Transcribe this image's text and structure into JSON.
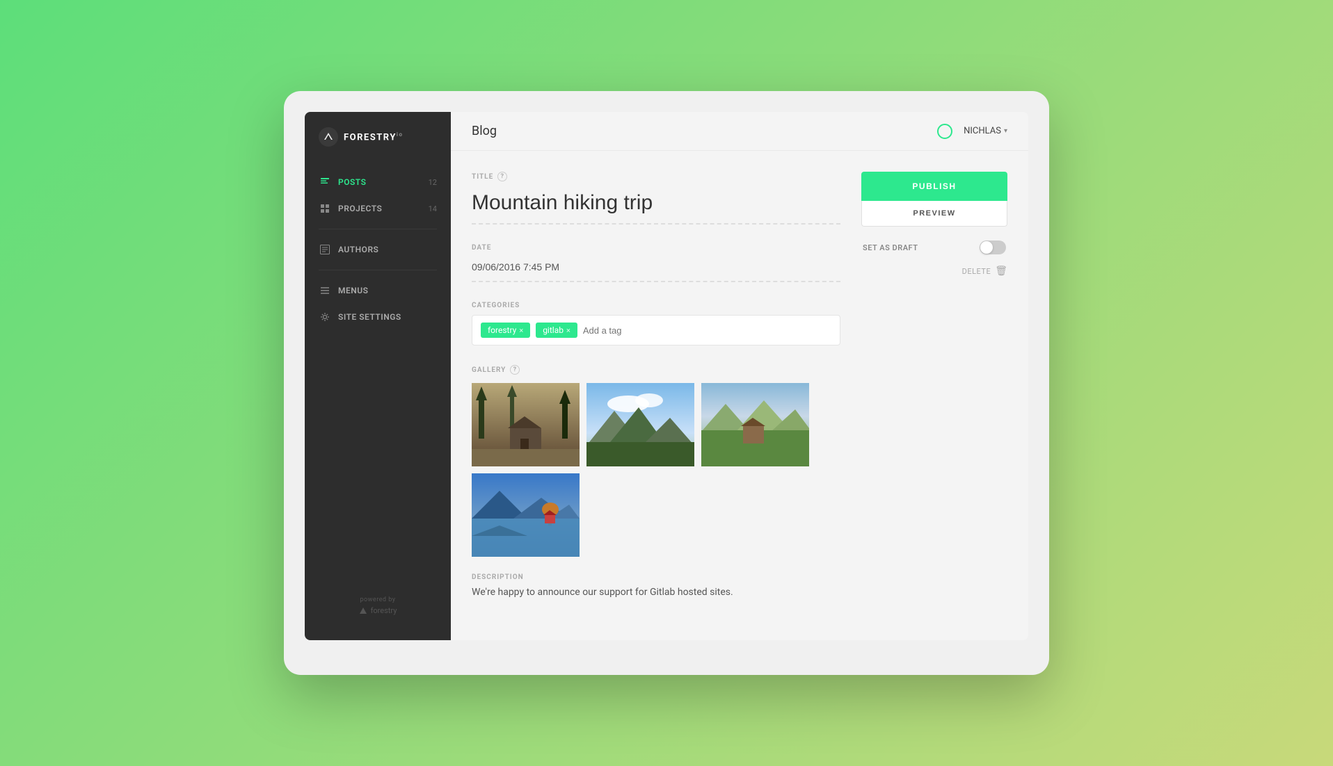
{
  "app": {
    "logo_text": "FORESTRY",
    "logo_version": "io"
  },
  "sidebar": {
    "items": [
      {
        "id": "posts",
        "label": "POSTS",
        "count": "12",
        "active": true
      },
      {
        "id": "projects",
        "label": "PROJECTS",
        "count": "14",
        "active": false
      },
      {
        "id": "authors",
        "label": "AUTHORS",
        "count": "",
        "active": false
      },
      {
        "id": "menus",
        "label": "MENUS",
        "count": "",
        "active": false
      },
      {
        "id": "site-settings",
        "label": "SITE SETTINGS",
        "count": "",
        "active": false
      }
    ],
    "footer": {
      "powered_by": "powered by",
      "footer_logo": "forestry"
    }
  },
  "topbar": {
    "title": "Blog",
    "user": "NICHLAS"
  },
  "form": {
    "title_label": "TITLE",
    "title_value": "Mountain hiking trip",
    "date_label": "DATE",
    "date_value": "09/06/2016 7:45 PM",
    "categories_label": "CATEGORIES",
    "tags": [
      "forestry",
      "gitlab"
    ],
    "tag_placeholder": "Add a tag",
    "gallery_label": "GALLERY",
    "description_label": "DESCRIPTION",
    "description_text": "We're happy to announce our support for Gitlab hosted sites."
  },
  "actions": {
    "publish_label": "PUBLISH",
    "preview_label": "PREVIEW",
    "draft_label": "SET AS DRAFT",
    "delete_label": "DELETE"
  },
  "colors": {
    "accent": "#2de88e",
    "sidebar_bg": "#2d2d2d",
    "active_nav": "#2de88e"
  }
}
